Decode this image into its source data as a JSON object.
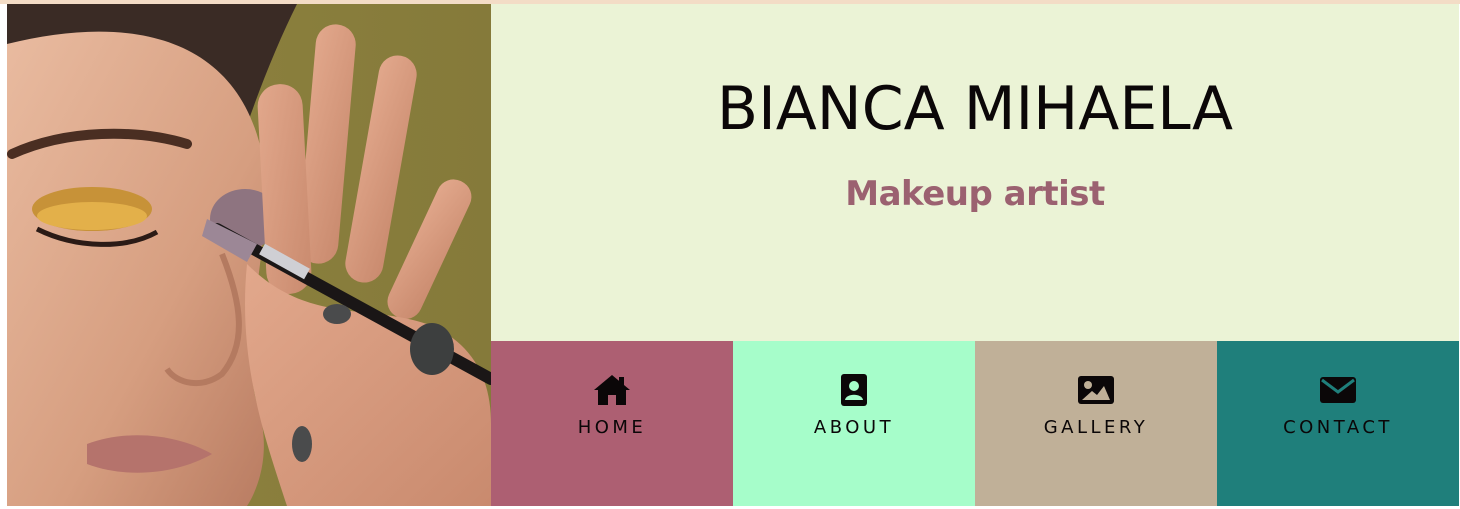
{
  "header": {
    "title": "BIANCA MIHAELA",
    "subtitle": "Makeup artist"
  },
  "colors": {
    "header_bg": "#ebf3d6",
    "title": "#0b0708",
    "subtitle": "#9b6170",
    "top_line": "#f3dcc6"
  },
  "nav": {
    "items": [
      {
        "label": "HOME",
        "icon": "home-icon",
        "color": "#ad5f72"
      },
      {
        "label": "ABOUT",
        "icon": "contact-card-icon",
        "color": "#a6fdca"
      },
      {
        "label": "GALLERY",
        "icon": "image-icon",
        "color": "#c0b098"
      },
      {
        "label": "CONTACT",
        "icon": "envelope-icon",
        "color": "#1f7f7b"
      }
    ]
  }
}
